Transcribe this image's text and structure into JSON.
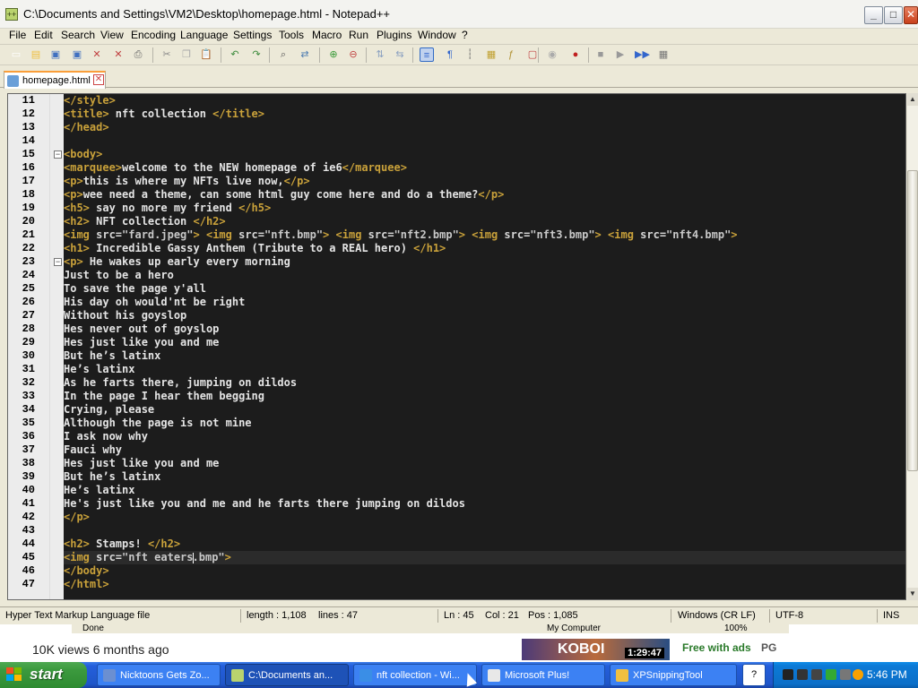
{
  "window": {
    "title": "C:\\Documents and Settings\\VM2\\Desktop\\homepage.html - Notepad++",
    "minimize_glyph": "_",
    "maximize_glyph": "□",
    "close_glyph": "✕"
  },
  "menu": [
    "File",
    "Edit",
    "Search",
    "View",
    "Encoding",
    "Language",
    "Settings",
    "Tools",
    "Macro",
    "Run",
    "Plugins",
    "Window",
    "?"
  ],
  "toolbar_icons": [
    "new-file-icon",
    "open-file-icon",
    "save-icon",
    "save-all-icon",
    "close-icon",
    "close-all-icon",
    "print-icon",
    "cut-icon",
    "copy-icon",
    "paste-icon",
    "undo-icon",
    "redo-icon",
    "find-icon",
    "replace-icon",
    "zoom-in-icon",
    "zoom-out-icon",
    "sync-vertical-icon",
    "sync-horizontal-icon",
    "word-wrap-icon",
    "show-all-chars-icon",
    "indent-guide-icon",
    "document-map-icon",
    "function-list-icon",
    "folder-workspace-icon",
    "monitoring-icon",
    "macro-record-icon",
    "macro-stop-icon",
    "macro-play-icon",
    "macro-play-multiple-icon",
    "macro-save-icon"
  ],
  "tab": {
    "label": "homepage.html",
    "close": "✕"
  },
  "editor": {
    "lines": [
      {
        "n": "11",
        "html": "<span class=\"tag\">&lt;/style&gt;</span>"
      },
      {
        "n": "12",
        "html": "<span class=\"tag\">&lt;title&gt;</span><span class=\"txt\"> nft collection </span><span class=\"tag\">&lt;/title&gt;</span>"
      },
      {
        "n": "13",
        "html": "<span class=\"tag\">&lt;/head&gt;</span>"
      },
      {
        "n": "14",
        "html": ""
      },
      {
        "n": "15",
        "html": "<span class=\"tag\">&lt;body&gt;</span>"
      },
      {
        "n": "16",
        "html": "<span class=\"tag\">&lt;marquee&gt;</span><span class=\"txt\">welcome to the NEW homepage of ie6</span><span class=\"tag\">&lt;/marquee&gt;</span>"
      },
      {
        "n": "17",
        "html": "<span class=\"tag\">&lt;p&gt;</span><span class=\"txt\">this is where my NFTs live now,</span><span class=\"tag\">&lt;/p&gt;</span>"
      },
      {
        "n": "18",
        "html": "<span class=\"tag\">&lt;p&gt;</span><span class=\"txt\">wee need a theme, can some html guy come here and do a theme?</span><span class=\"tag\">&lt;/p&gt;</span>"
      },
      {
        "n": "19",
        "html": "<span class=\"tag\">&lt;h5&gt;</span><span class=\"txt\"> say no more my friend </span><span class=\"tag\">&lt;/h5&gt;</span>"
      },
      {
        "n": "20",
        "html": "<span class=\"tag\">&lt;h2&gt;</span><span class=\"txt\"> NFT collection </span><span class=\"tag\">&lt;/h2&gt;</span>"
      },
      {
        "n": "21",
        "html": "<span class=\"tag\">&lt;img </span><span class=\"attr\">src=</span><span class=\"str\">\"fard.jpeg\"</span><span class=\"tag\">&gt;</span> <span class=\"tag\">&lt;img </span><span class=\"attr\">src=</span><span class=\"str\">\"nft.bmp\"</span><span class=\"tag\">&gt;</span> <span class=\"tag\">&lt;img </span><span class=\"attr\">src=</span><span class=\"str\">\"nft2.bmp\"</span><span class=\"tag\">&gt;</span> <span class=\"tag\">&lt;img </span><span class=\"attr\">src=</span><span class=\"str\">\"nft3.bmp\"</span><span class=\"tag\">&gt;</span> <span class=\"tag\">&lt;img </span><span class=\"attr\">src=</span><span class=\"str\">\"nft4.bmp\"</span><span class=\"tag\">&gt;</span>"
      },
      {
        "n": "22",
        "html": "<span class=\"tag\">&lt;h1&gt;</span><span class=\"txt\"> Incredible Gassy Anthem (Tribute to a REAL hero) </span><span class=\"tag\">&lt;/h1&gt;</span>"
      },
      {
        "n": "23",
        "html": "<span class=\"tag\">&lt;p&gt;</span><span class=\"txt\"> He wakes up early every morning</span>"
      },
      {
        "n": "24",
        "html": "<span class=\"txt\">Just to be a hero</span>"
      },
      {
        "n": "25",
        "html": "<span class=\"txt\">To save the page y'all</span>"
      },
      {
        "n": "26",
        "html": "<span class=\"txt\">His day oh would'nt be right</span>"
      },
      {
        "n": "27",
        "html": "<span class=\"txt\">Without his goyslop</span>"
      },
      {
        "n": "28",
        "html": "<span class=\"txt\">Hes never out of goyslop</span>"
      },
      {
        "n": "29",
        "html": "<span class=\"txt\">Hes just like you and me</span>"
      },
      {
        "n": "30",
        "html": "<span class=\"txt\">But he’s latinx</span>"
      },
      {
        "n": "31",
        "html": "<span class=\"txt\">He’s latinx</span>"
      },
      {
        "n": "32",
        "html": "<span class=\"txt\">As he farts there, jumping on dildos</span>"
      },
      {
        "n": "33",
        "html": "<span class=\"txt\">In the page I hear them begging</span>"
      },
      {
        "n": "34",
        "html": "<span class=\"txt\">Crying, please</span>"
      },
      {
        "n": "35",
        "html": "<span class=\"txt\">Although the page is not mine</span>"
      },
      {
        "n": "36",
        "html": "<span class=\"txt\">I ask now why</span>"
      },
      {
        "n": "37",
        "html": "<span class=\"txt\">Fauci why</span>"
      },
      {
        "n": "38",
        "html": "<span class=\"txt\">Hes just like you and me</span>"
      },
      {
        "n": "39",
        "html": "<span class=\"txt\">But he’s latinx</span>"
      },
      {
        "n": "40",
        "html": "<span class=\"txt\">He’s latinx</span>"
      },
      {
        "n": "41",
        "html": "<span class=\"txt\">He's just like you and me and he farts there jumping on dildos</span>"
      },
      {
        "n": "42",
        "html": "<span class=\"tag\">&lt;/p&gt;</span>"
      },
      {
        "n": "43",
        "html": ""
      },
      {
        "n": "44",
        "html": "<span class=\"tag\">&lt;h2&gt;</span><span class=\"txt\"> Stamps! </span><span class=\"tag\">&lt;/h2&gt;</span>"
      },
      {
        "n": "45",
        "html": "<span class=\"tag\">&lt;img </span><span class=\"attr\">src=</span><span class=\"str\">\"nft eaters<i class=\"caret\"></i>.bmp\"</span><span class=\"tag\">&gt;</span>",
        "current": true
      },
      {
        "n": "46",
        "html": "<span class=\"tag\">&lt;/body&gt;</span>"
      },
      {
        "n": "47",
        "html": "<span class=\"tag\">&lt;/html&gt;</span>"
      }
    ],
    "fold_markers": [
      "15",
      "23"
    ]
  },
  "statusbar": {
    "filetype": "Hyper Text Markup Language file",
    "length": "length : 1,108",
    "lines": "lines : 47",
    "ln": "Ln : 45",
    "col": "Col : 21",
    "pos": "Pos : 1,085",
    "eol": "Windows (CR LF)",
    "encoding": "UTF-8",
    "mode": "INS"
  },
  "overlay": {
    "ie_done": "Done",
    "ie_zone": "My Computer",
    "ie_zoom": "100%",
    "views": "10K views  6 months ago",
    "thumb_text": "KOBOI",
    "thumb_time": "1:29:47",
    "free_ads": "Free with ads",
    "rating": "PG"
  },
  "taskbar": {
    "start": "start",
    "tasks": [
      {
        "label": "Nicktoons Gets Zo...",
        "icon_color": "#6b8fd1"
      },
      {
        "label": "C:\\Documents an...",
        "icon_color": "#b9d36e",
        "active": true
      },
      {
        "label": "nft collection - Wi...",
        "icon_color": "#3a8ee6"
      },
      {
        "label": "Microsoft Plus!",
        "icon_color": "#e8e8e8"
      },
      {
        "label": "XPSnippingTool",
        "icon_color": "#f0c040"
      }
    ],
    "clock": "5:46 PM"
  }
}
